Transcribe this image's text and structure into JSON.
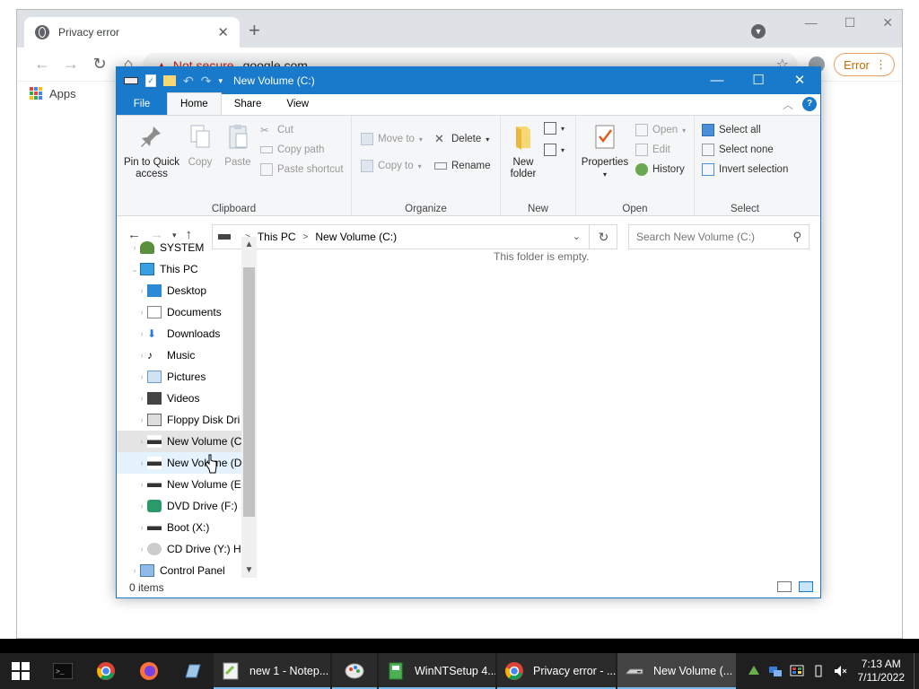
{
  "chrome": {
    "tab_title": "Privacy error",
    "tab_close": "✕",
    "new_tab": "+",
    "not_secure": "Not secure",
    "url": "google.com",
    "error_btn": "Error",
    "bookmarks_apps": "Apps"
  },
  "explorer": {
    "title": "New Volume (C:)",
    "tabs": [
      "File",
      "Home",
      "Share",
      "View"
    ],
    "ribbon": {
      "clipboard": {
        "label": "Clipboard",
        "pin": "Pin to Quick\naccess",
        "copy": "Copy",
        "paste": "Paste",
        "cut": "Cut",
        "copy_path": "Copy path",
        "paste_shortcut": "Paste shortcut"
      },
      "organize": {
        "label": "Organize",
        "move_to": "Move to",
        "copy_to": "Copy to",
        "delete": "Delete",
        "rename": "Rename"
      },
      "new": {
        "label": "New",
        "new_folder": "New\nfolder"
      },
      "open": {
        "label": "Open",
        "properties": "Properties",
        "open": "Open",
        "edit": "Edit",
        "history": "History"
      },
      "select": {
        "label": "Select",
        "select_all": "Select all",
        "select_none": "Select none",
        "invert_selection": "Invert selection"
      }
    },
    "address": {
      "crumbs": [
        "This PC",
        "New Volume (C:)"
      ],
      "search_placeholder": "Search New Volume (C:)"
    },
    "nav": [
      {
        "label": "SYSTEM",
        "level": 0
      },
      {
        "label": "This PC",
        "level": 0,
        "expanded": true
      },
      {
        "label": "Desktop",
        "level": 1
      },
      {
        "label": "Documents",
        "level": 1
      },
      {
        "label": "Downloads",
        "level": 1
      },
      {
        "label": "Music",
        "level": 1
      },
      {
        "label": "Pictures",
        "level": 1
      },
      {
        "label": "Videos",
        "level": 1
      },
      {
        "label": "Floppy Disk Dri",
        "level": 1
      },
      {
        "label": "New Volume (C",
        "level": 1,
        "selected": true
      },
      {
        "label": "New Volume (D",
        "level": 1,
        "hover": true
      },
      {
        "label": "New Volume (E",
        "level": 1
      },
      {
        "label": "DVD Drive (F:) S",
        "level": 1
      },
      {
        "label": "Boot (X:)",
        "level": 1
      },
      {
        "label": "CD Drive (Y:) H",
        "level": 1
      },
      {
        "label": "Control Panel",
        "level": 0
      }
    ],
    "empty_message": "This folder is empty.",
    "status": "0 items"
  },
  "taskbar": {
    "tasks": [
      {
        "label": "new 1 - Notep...",
        "icon": "notepadpp-icon"
      },
      {
        "label": "WinNTSetup 4...",
        "icon": "winntsetup-icon"
      },
      {
        "label": "Privacy error - ...",
        "icon": "chrome-icon"
      },
      {
        "label": "New Volume (...",
        "icon": "explorer-drive-icon",
        "active": true
      }
    ],
    "time": "7:13 AM",
    "date": "7/11/2022"
  },
  "colors": {
    "explorer_accent": "#1979ca",
    "taskbar_bg": "#1f1f1f",
    "chrome_error": "#c5221f"
  }
}
